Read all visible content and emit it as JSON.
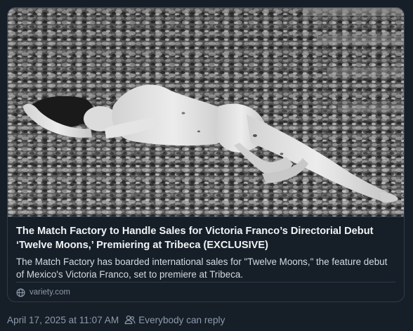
{
  "link_card": {
    "image_alt": "Black and white film still: a woman lying on a field of flowers",
    "title": "The Match Factory to Handle Sales for Victoria Franco’s Directorial Debut ‘Twelve Moons,’ Premiering at Tribeca (EXCLUSIVE)",
    "description": "The Match Factory has boarded international sales for \"Twelve Moons,\" the feature debut of Mexico's Victoria Franco, set to premiere at Tribeca.",
    "source_icon": "globe-icon",
    "source": "variety.com"
  },
  "post_meta": {
    "timestamp": "April 17, 2025 at 11:07 AM",
    "reply_icon": "people-icon",
    "reply_setting": "Everybody can reply"
  },
  "colors": {
    "background": "#161e27",
    "border": "#2e3c4d",
    "title": "#f1f3f5",
    "body_text": "#d4dbe2",
    "muted": "#8c9bac"
  }
}
